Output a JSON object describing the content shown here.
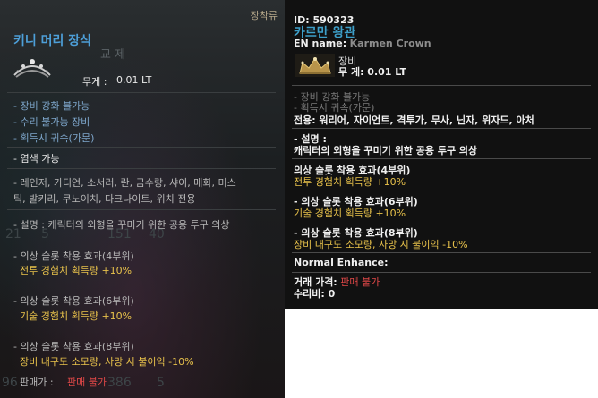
{
  "left": {
    "category": "장착류",
    "title": "키니 머리 장식",
    "exchange_hint": "교 제",
    "icon": "tiara-icon",
    "weight_label": "무게 :",
    "weight_value": "0.01 LT",
    "restrictions": [
      "- 장비 강화 불가능",
      "- 수리 불가능 장비",
      "- 획득시 귀속(가문)"
    ],
    "dye": "- 염색 가능",
    "classes_line1": "- 레인저, 가디언, 소서러, 란, 금수랑, 샤이, 매화, 미스",
    "classes_line2": "틱, 발키리, 쿠노이치, 다크나이트, 위치 전용",
    "description": "- 설명 : 캐릭터의 외형을 꾸미기 위한 공용 투구 의상",
    "effects": [
      {
        "title": "- 의상 슬롯 착용 효과(4부위)",
        "value": "전투 경험치 획득량 +10%"
      },
      {
        "title": "- 의상 슬롯 착용 효과(6부위)",
        "value": "기술 경험치 획득량 +10%"
      },
      {
        "title": "- 의상 슬롯 착용 효과(8부위)",
        "value": "장비 내구도 소모량, 사망 시 불이익 -10%"
      }
    ],
    "trade_label": "판매가 :",
    "trade_value": "판매 불가",
    "bg_numbers": [
      "21",
      "5",
      "151",
      "40",
      "96",
      "386",
      "5"
    ]
  },
  "right": {
    "id_label": "ID:",
    "id_value": "590323",
    "name_kr": "카르만 왕관",
    "en_label": "EN name:",
    "en_value": "Karmen Crown",
    "icon": "crown-icon",
    "type": "장비",
    "weight": "무 게: 0.01 LT",
    "restrictions": [
      "- 장비 강화 불가능",
      "- 획득시 귀속(가문)"
    ],
    "usage": "전용: 워리어, 자이언트, 격투가, 무사, 닌자, 위자드, 아처",
    "desc_title": "- 설명 :",
    "desc_text": "캐릭터의 외형을 꾸미기 위한 공용 투구 의상",
    "effects": [
      {
        "title": "의상 슬롯 착용 효과(4부위)",
        "value": "전투 경험치 획득량 +10%"
      },
      {
        "title": "- 의상 슬롯 착용 효과(6부위)",
        "value": "기술 경험치 획득량 +10%"
      },
      {
        "title": "- 의상 슬롯 착용 효과(8부위)",
        "value": "장비 내구도 소모량, 사망 시 불이익 -10%"
      }
    ],
    "enhance": "Normal Enhance:",
    "trade_label": "거래 가격:",
    "trade_value": "판매 불가",
    "repair": "수리비: 0"
  }
}
